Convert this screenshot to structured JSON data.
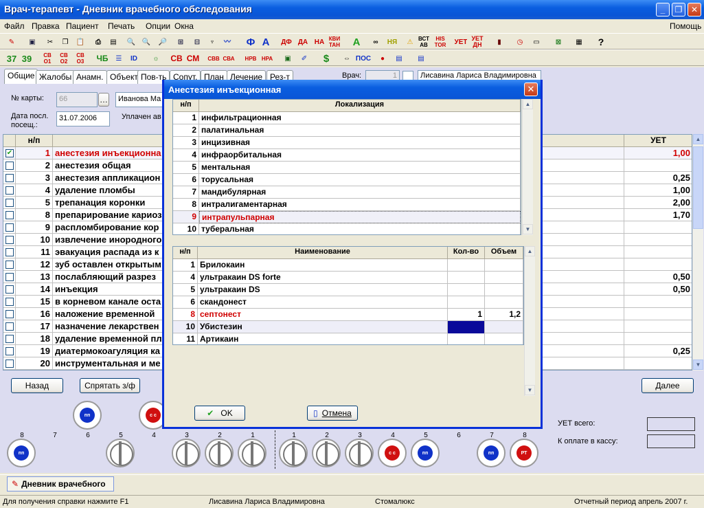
{
  "window": {
    "title": "Врач-терапевт - Дневник врачебного обследования"
  },
  "menu": [
    "Файл",
    "Правка",
    "Пациент",
    "Печать",
    "Опции",
    "Окна"
  ],
  "menu_help": "Помощь",
  "toolbar1": [
    "ДФ",
    "ДА",
    "НА",
    "КВИ ТАН",
    "НЯ",
    "ВСТ АВ",
    "HIS TOR",
    "УЕТ",
    "УЕТ ДН"
  ],
  "toolbar2": [
    "37",
    "39",
    "СВ О1",
    "СВ О2",
    "СВ О3",
    "ЧБ",
    "СВ",
    "СМ",
    "СВВ",
    "СВА",
    "НРВ",
    "НРА",
    "ПОС"
  ],
  "tabs": [
    "Общие",
    "Жалобы",
    "Анамн.",
    "Объект.",
    "Пов-ть",
    "Сопут.",
    "План",
    "Лечение",
    "Рез-т"
  ],
  "doctor": {
    "label": "Врач:",
    "code": "1",
    "name": "Лисавина Лариса Владимировна"
  },
  "patient": {
    "card_label": "№ карты:",
    "card_value": "66",
    "name_value": "Иванова Ма",
    "last_visit_label": "Дата посл. посещ.:",
    "last_visit_value": "31.07.2006",
    "paid_label": "Уплачен ав"
  },
  "grid": {
    "col_np": "н/п",
    "col_uet": "УЕТ",
    "rows": [
      {
        "n": "1",
        "name": "анестезия инъекционна",
        "uet": "1,00",
        "checked": true,
        "red": true
      },
      {
        "n": "2",
        "name": "анестезия общая",
        "uet": ""
      },
      {
        "n": "3",
        "name": "анестезия аппликацион",
        "uet": "0,25"
      },
      {
        "n": "4",
        "name": "удаление пломбы",
        "uet": "1,00"
      },
      {
        "n": "5",
        "name": "трепанация коронки",
        "uet": "2,00"
      },
      {
        "n": "8",
        "name": "препарирование кариоз",
        "uet": "1,70"
      },
      {
        "n": "9",
        "name": "распломбирование кор",
        "uet": ""
      },
      {
        "n": "10",
        "name": "извлечение инородного",
        "uet": ""
      },
      {
        "n": "11",
        "name": "эвакуация распада из к",
        "uet": ""
      },
      {
        "n": "12",
        "name": "зуб оставлен открытым",
        "uet": ""
      },
      {
        "n": "13",
        "name": "послабляющий разрез",
        "uet": "0,50"
      },
      {
        "n": "14",
        "name": "инъекция",
        "uet": "0,50"
      },
      {
        "n": "15",
        "name": "в корневом канале оста",
        "uet": ""
      },
      {
        "n": "16",
        "name": "наложение временной",
        "uet": ""
      },
      {
        "n": "17",
        "name": "назначение лекарствен",
        "uet": ""
      },
      {
        "n": "18",
        "name": "удаление временной пл",
        "uet": ""
      },
      {
        "n": "19",
        "name": "диатермокоагуляция ка",
        "uet": "0,25"
      },
      {
        "n": "20",
        "name": "инструментальная и ме",
        "uet": ""
      }
    ]
  },
  "buttons": {
    "back": "Назад",
    "hide": "Спрятать з/ф",
    "next": "Далее"
  },
  "teeth_upper": [
    {
      "n": "8",
      "mark": "пп",
      "color": "#1032c8"
    },
    {
      "n": "7",
      "mark": "",
      "color": ""
    },
    {
      "n": "6",
      "mark": "пп",
      "color": "#1032c8"
    },
    {
      "n": "5",
      "mark": "",
      "color": ""
    },
    {
      "n": "4",
      "mark": "с с",
      "color": "#d01010"
    },
    {
      "n": "3",
      "mark": "",
      "color": ""
    },
    {
      "n": "2",
      "mark": "",
      "color": ""
    },
    {
      "n": "1",
      "mark": "",
      "color": ""
    },
    {
      "n": "1",
      "mark": "",
      "color": ""
    },
    {
      "n": "2",
      "mark": "",
      "color": ""
    },
    {
      "n": "3",
      "mark": "",
      "color": ""
    },
    {
      "n": "4",
      "mark": "с с",
      "color": "#d01010"
    },
    {
      "n": "5",
      "mark": "пп",
      "color": "#1032c8"
    },
    {
      "n": "6",
      "mark": "",
      "color": ""
    },
    {
      "n": "7",
      "mark": "пп",
      "color": "#1032c8"
    },
    {
      "n": "8",
      "mark": "РТ",
      "color": "#d01010"
    }
  ],
  "totals": {
    "uet_label": "УЕТ всего:",
    "pay_label": "К оплате в кассу:"
  },
  "dialog": {
    "title": "Анестезия инъекционная",
    "loc_header_np": "н/п",
    "loc_header_name": "Локализация",
    "loc_rows": [
      {
        "n": "1",
        "name": "инфильтрационная"
      },
      {
        "n": "2",
        "name": "палатинальная"
      },
      {
        "n": "3",
        "name": "инцизивная"
      },
      {
        "n": "4",
        "name": "инфраорбитальная"
      },
      {
        "n": "5",
        "name": "ментальная"
      },
      {
        "n": "6",
        "name": "торусальная"
      },
      {
        "n": "7",
        "name": "мандибулярная"
      },
      {
        "n": "8",
        "name": "интралигаментарная"
      },
      {
        "n": "9",
        "name": "интрапульпарная",
        "red": true
      },
      {
        "n": "10",
        "name": "туберальная"
      }
    ],
    "drug_header_np": "н/п",
    "drug_header_name": "Наименование",
    "drug_header_qty": "Кол-во",
    "drug_header_vol": "Объем",
    "drug_rows": [
      {
        "n": "1",
        "name": "Брилокаин",
        "qty": "",
        "vol": ""
      },
      {
        "n": "4",
        "name": "ультракаин DS forte",
        "qty": "",
        "vol": ""
      },
      {
        "n": "5",
        "name": "ультракаин DS",
        "qty": "",
        "vol": ""
      },
      {
        "n": "6",
        "name": "скандонест",
        "qty": "",
        "vol": ""
      },
      {
        "n": "8",
        "name": "септонест",
        "qty": "1",
        "vol": "1,2",
        "red": true
      },
      {
        "n": "10",
        "name": "Убистезин",
        "qty": "",
        "vol": "",
        "selected": true
      },
      {
        "n": "11",
        "name": "Артикаин",
        "qty": "",
        "vol": ""
      }
    ],
    "ok": "OK",
    "cancel": "Отмена"
  },
  "taskbar": {
    "item": "Дневник врачебного"
  },
  "status": {
    "help": "Для получения справки нажмите F1",
    "user": "Лисавина Лариса Владимировна",
    "org": "Стомалюкс",
    "period": "Отчетный период апрель 2007 г."
  }
}
